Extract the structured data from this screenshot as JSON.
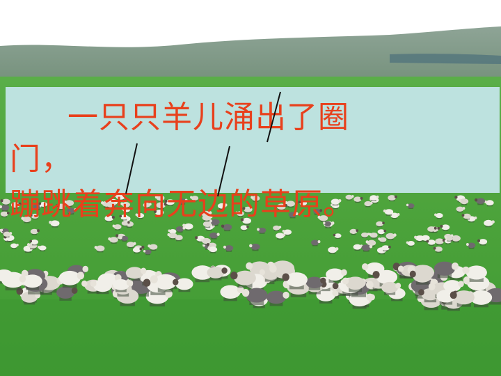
{
  "slide": {
    "text_lines": [
      "一只只羊儿涌出了圈",
      "门，",
      "蹦跳着奔向无边的草原。"
    ]
  },
  "colors": {
    "text": "#e8401c",
    "caption_panel": "#bde2df",
    "grass": "#4fa63a",
    "hill": "#7f9a88",
    "sky": "#ffffff"
  },
  "icons": [
    "sheep-flock",
    "pause-mark"
  ]
}
